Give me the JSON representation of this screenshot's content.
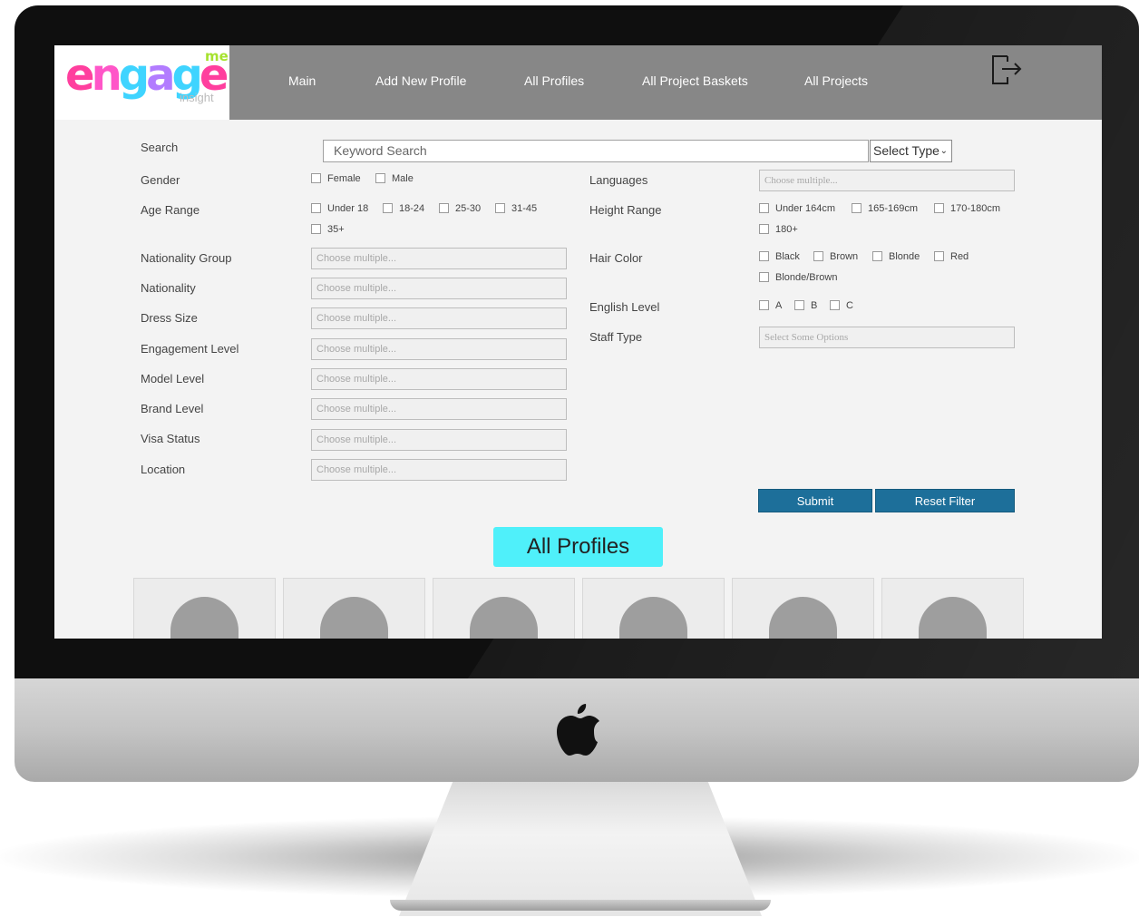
{
  "logo": {
    "letters": [
      "e",
      "n",
      "g",
      "a",
      "g",
      "e"
    ],
    "me": "me",
    "tagline": "insight"
  },
  "nav": {
    "items": [
      "Main",
      "Add New Profile",
      "All Profiles",
      "All Project Baskets",
      "All Projects"
    ],
    "logout_icon": "logout-icon"
  },
  "search": {
    "label": "Search",
    "placeholder": "Keyword Search",
    "type_select": "Select Type"
  },
  "filters": {
    "gender": {
      "label": "Gender",
      "options": [
        "Female",
        "Male"
      ]
    },
    "age_range": {
      "label": "Age Range",
      "options": [
        "Under 18",
        "18-24",
        "25-30",
        "31-45",
        "35+"
      ]
    },
    "nationality_group": {
      "label": "Nationality Group",
      "placeholder": "Choose multiple..."
    },
    "nationality": {
      "label": "Nationality",
      "placeholder": "Choose multiple..."
    },
    "dress_size": {
      "label": "Dress Size",
      "placeholder": "Choose multiple..."
    },
    "engagement_level": {
      "label": "Engagement Level",
      "placeholder": "Choose multiple..."
    },
    "model_level": {
      "label": "Model Level",
      "placeholder": "Choose multiple..."
    },
    "brand_level": {
      "label": "Brand Level",
      "placeholder": "Choose multiple..."
    },
    "visa_status": {
      "label": "Visa Status",
      "placeholder": "Choose multiple..."
    },
    "location": {
      "label": "Location",
      "placeholder": "Choose multiple..."
    },
    "languages": {
      "label": "Languages",
      "placeholder": "Choose multiple..."
    },
    "height_range": {
      "label": "Height Range",
      "options": [
        "Under 164cm",
        "165-169cm",
        "170-180cm",
        "180+"
      ]
    },
    "hair_color": {
      "label": "Hair Color",
      "options": [
        "Black",
        "Brown",
        "Blonde",
        "Red",
        "Blonde/Brown"
      ]
    },
    "english_level": {
      "label": "English Level",
      "options": [
        "A",
        "B",
        "C"
      ]
    },
    "staff_type": {
      "label": "Staff Type",
      "placeholder": "Select Some Options"
    }
  },
  "actions": {
    "submit": "Submit",
    "reset": "Reset Filter"
  },
  "profiles": {
    "title": "All Profiles"
  },
  "colors": {
    "navbar": "#878787",
    "button": "#1d6f9a",
    "section_title": "#4ff0fa",
    "avatar": "#9e9e9e"
  }
}
